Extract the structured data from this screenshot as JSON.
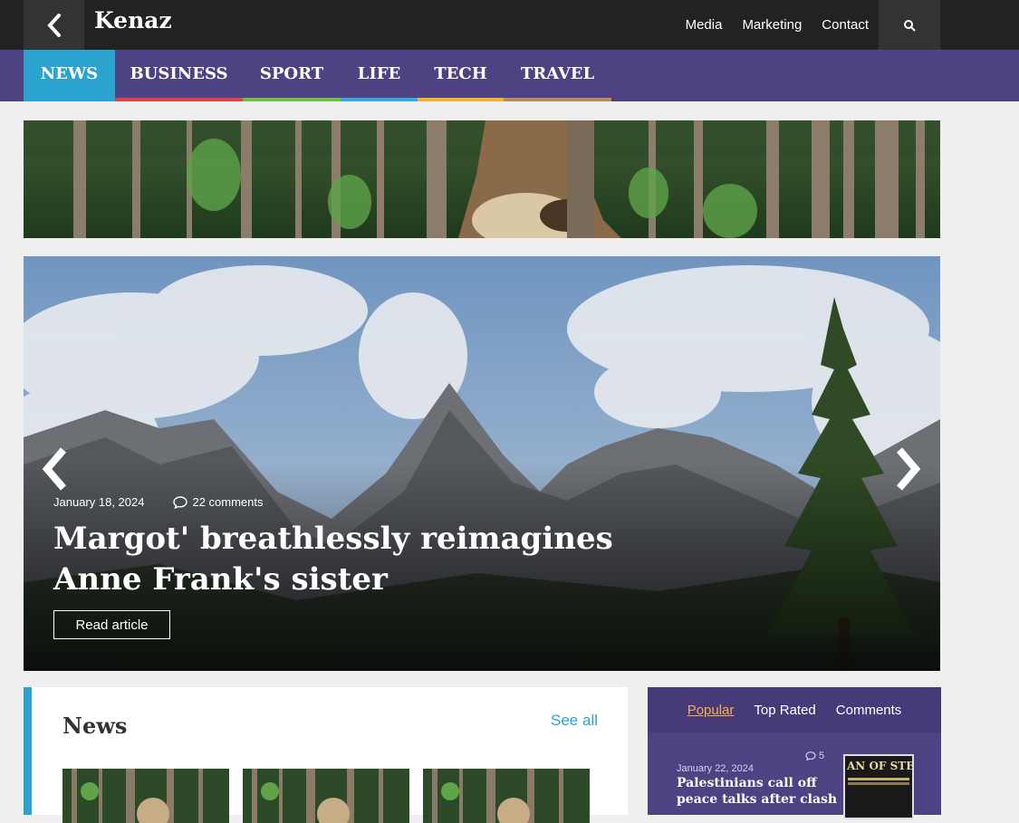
{
  "header": {
    "logo": "Kenaz",
    "links": [
      "Media",
      "Marketing",
      "Contact"
    ],
    "back_icon": "chevron-left-icon",
    "search_icon": "search-icon"
  },
  "categories": [
    {
      "label": "NEWS",
      "color": "#2ba3cf",
      "active": true
    },
    {
      "label": "BUSINESS",
      "color": "#d64550"
    },
    {
      "label": "SPORT",
      "color": "#6cc04a"
    },
    {
      "label": "LIFE",
      "color": "#3aa7e0"
    },
    {
      "label": "TECH",
      "color": "#f2b33d"
    },
    {
      "label": "TRAVEL",
      "color": "#b08d5b"
    }
  ],
  "hero": {
    "date": "January 18, 2024",
    "comments": "22 comments",
    "title": "Margot' breathlessly reimagines Anne Frank's sister",
    "cta": "Read article"
  },
  "news_section": {
    "title": "News",
    "see_all": "See all"
  },
  "sidebar": {
    "tabs": [
      "Popular",
      "Top Rated",
      "Comments"
    ],
    "active_tab": "Popular",
    "item": {
      "date": "January 22, 2024",
      "comment_count": "5",
      "title": "Palestinians call off peace talks after clash",
      "thumb_text": "AN OF STE"
    }
  }
}
